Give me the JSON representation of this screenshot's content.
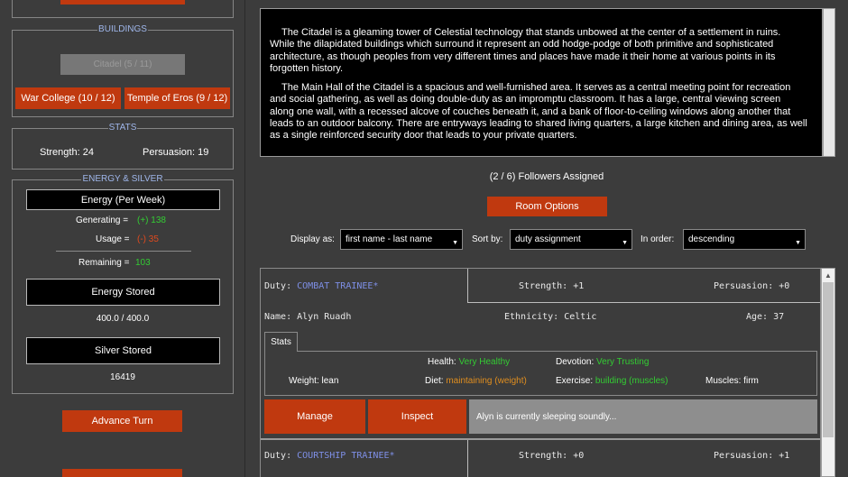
{
  "buildings": {
    "title": "BUILDINGS",
    "citadel": "Citadel (5 / 11)",
    "war_college": "War College (10 / 12)",
    "temple": "Temple of Eros (9 / 12)"
  },
  "stats": {
    "title": "STATS",
    "strength": "Strength: 24",
    "persuasion": "Persuasion: 19"
  },
  "energy": {
    "title": "ENERGY & SILVER",
    "per_week_label": "Energy (Per Week)",
    "generating_label": "Generating =",
    "generating_value": "(+) 138",
    "usage_label": "Usage =",
    "usage_value": "(-) 35",
    "remaining_label": "Remaining =",
    "remaining_value": "103",
    "stored_label": "Energy Stored",
    "stored_value": "400.0 / 400.0",
    "silver_label": "Silver Stored",
    "silver_value": "16419"
  },
  "advance_turn": "Advance Turn",
  "description": {
    "p1": "The Citadel is a gleaming tower of Celestial technology that stands unbowed at the center of a settlement in ruins. While the dilapidated buildings which surround it represent an odd hodge-podge of both primitive and sophisticated architecture, as though peoples from very different times and places have made it their home at various points in its forgotten history.",
    "p2": "The Main Hall of the Citadel is a spacious and well-furnished area. It serves as a central meeting point for recreation and social gathering, as well as doing double-duty as an impromptu classroom. It has a large, central viewing screen along one wall, with a recessed alcove of couches beneath it, and a bank of floor-to-ceiling windows along another that leads to an outdoor balcony. There are entryways leading to shared living quarters, a large kitchen and dining area, as well as a single reinforced security door that leads to your private quarters."
  },
  "followers_assigned": "(2 / 6) Followers Assigned",
  "room_options": "Room Options",
  "filters": {
    "display_label": "Display as:",
    "display_value": "first name - last name",
    "sort_label": "Sort by:",
    "sort_value": "duty assignment",
    "order_label": "In order:",
    "order_value": "descending"
  },
  "followers": [
    {
      "duty_label": "Duty:",
      "duty_value": "COMBAT TRAINEE*",
      "strength": "Strength: +1",
      "persuasion": "Persuasion: +0",
      "name_label": "Name:",
      "name_value": "Alyn Ruadh",
      "ethnicity_label": "Ethnicity:",
      "ethnicity_value": "Celtic",
      "age_label": "Age:",
      "age_value": "37",
      "stats_tab": "Stats",
      "health_label": "Health:",
      "health_value": "Very Healthy",
      "devotion_label": "Devotion:",
      "devotion_value": "Very Trusting",
      "weight": "Weight: lean",
      "diet_label": "Diet:",
      "diet_value": "maintaining (weight)",
      "exercise_label": "Exercise:",
      "exercise_value": "building (muscles)",
      "muscles": "Muscles: firm",
      "manage": "Manage",
      "inspect": "Inspect",
      "status": "Alyn is currently sleeping soundly..."
    },
    {
      "duty_label": "Duty:",
      "duty_value": "COURTSHIP TRAINEE*",
      "strength": "Strength: +0",
      "persuasion": "Persuasion: +1"
    }
  ],
  "colors": {
    "accent": "#c0390f",
    "positive": "#33cc33",
    "negative": "#e04a1e",
    "caution": "#e08e1f",
    "duty": "#7e8fe6"
  },
  "icons": {
    "dropdown": "caret-down-icon",
    "scroll_up": "arrow-up-icon"
  }
}
